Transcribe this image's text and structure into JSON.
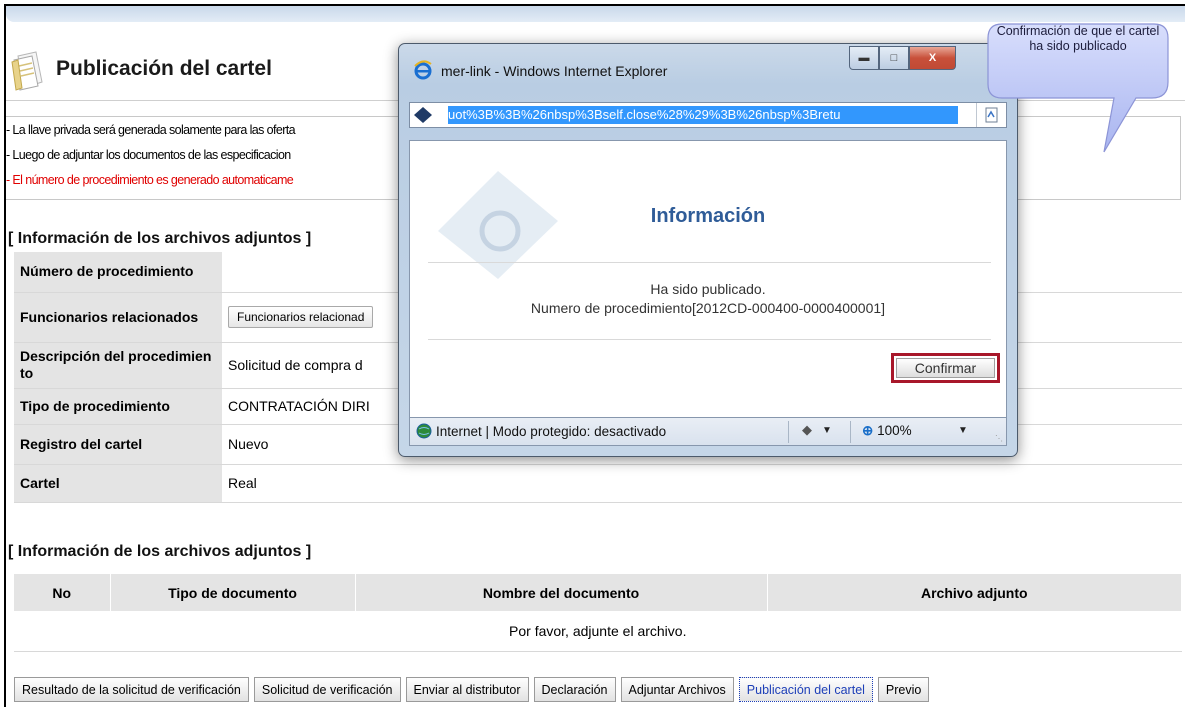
{
  "page": {
    "title": "Publicación del cartel",
    "notices": [
      {
        "text": "- La llave privada será generada solamente para las oferta",
        "color": "#000000"
      },
      {
        "text": "- Luego de adjuntar los documentos de las especificacion",
        "color": "#000000"
      },
      {
        "text": "- El número de procedimiento es generado automaticame",
        "color": "#e00000"
      }
    ]
  },
  "info_section": {
    "title": "[ Información de los archivos adjuntos ]",
    "rows": [
      {
        "label": "Número de procedimiento",
        "value": ""
      },
      {
        "label": "Funcionarios relacionados",
        "button": "Funcionarios relacionad"
      },
      {
        "label": "Descripción del procedimiento",
        "value": "Solicitud de compra d"
      },
      {
        "label": "Tipo de procedimiento",
        "value": "CONTRATACIÓN DIRI"
      },
      {
        "label": "Registro del cartel",
        "value": "Nuevo"
      },
      {
        "label": "Cartel",
        "value": "Real"
      }
    ]
  },
  "files_section": {
    "title": "[ Información de los archivos adjuntos ]",
    "columns": [
      "No",
      "Tipo de documento",
      "Nombre del documento",
      "Archivo adjunto"
    ],
    "empty_message": "Por favor, adjunte el archivo."
  },
  "bottom_buttons": [
    {
      "label": "Resultado de la solicitud de verificación",
      "active": false
    },
    {
      "label": "Solicitud de verificación",
      "active": false
    },
    {
      "label": "Enviar al distributor",
      "active": false
    },
    {
      "label": "Declaración",
      "active": false
    },
    {
      "label": "Adjuntar Archivos",
      "active": false
    },
    {
      "label": "Publicación del cartel",
      "active": true
    },
    {
      "label": "Previo",
      "active": false
    }
  ],
  "popup": {
    "window_title": "mer-link - Windows Internet Explorer",
    "address": "uot%3B%3B%26nbsp%3Bself.close%28%29%3B%26nbsp%3Bretu",
    "heading": "Información",
    "message_line1": "Ha sido publicado.",
    "message_line2": "Numero de procedimiento[2012CD-000400-0000400001]",
    "confirm_label": "Confirmar",
    "status_text": "Internet | Modo protegido: desactivado",
    "zoom": "100%",
    "icons": [
      "ie-icon",
      "minimize-icon",
      "maximize-icon",
      "close-icon",
      "page-icon",
      "compat-icon",
      "globe-icon",
      "protected-mode-icon",
      "zoom-icon"
    ]
  },
  "callout": {
    "text": "Confirmación de que el cartel ha sido publicado",
    "color": "#bcc6f5"
  }
}
